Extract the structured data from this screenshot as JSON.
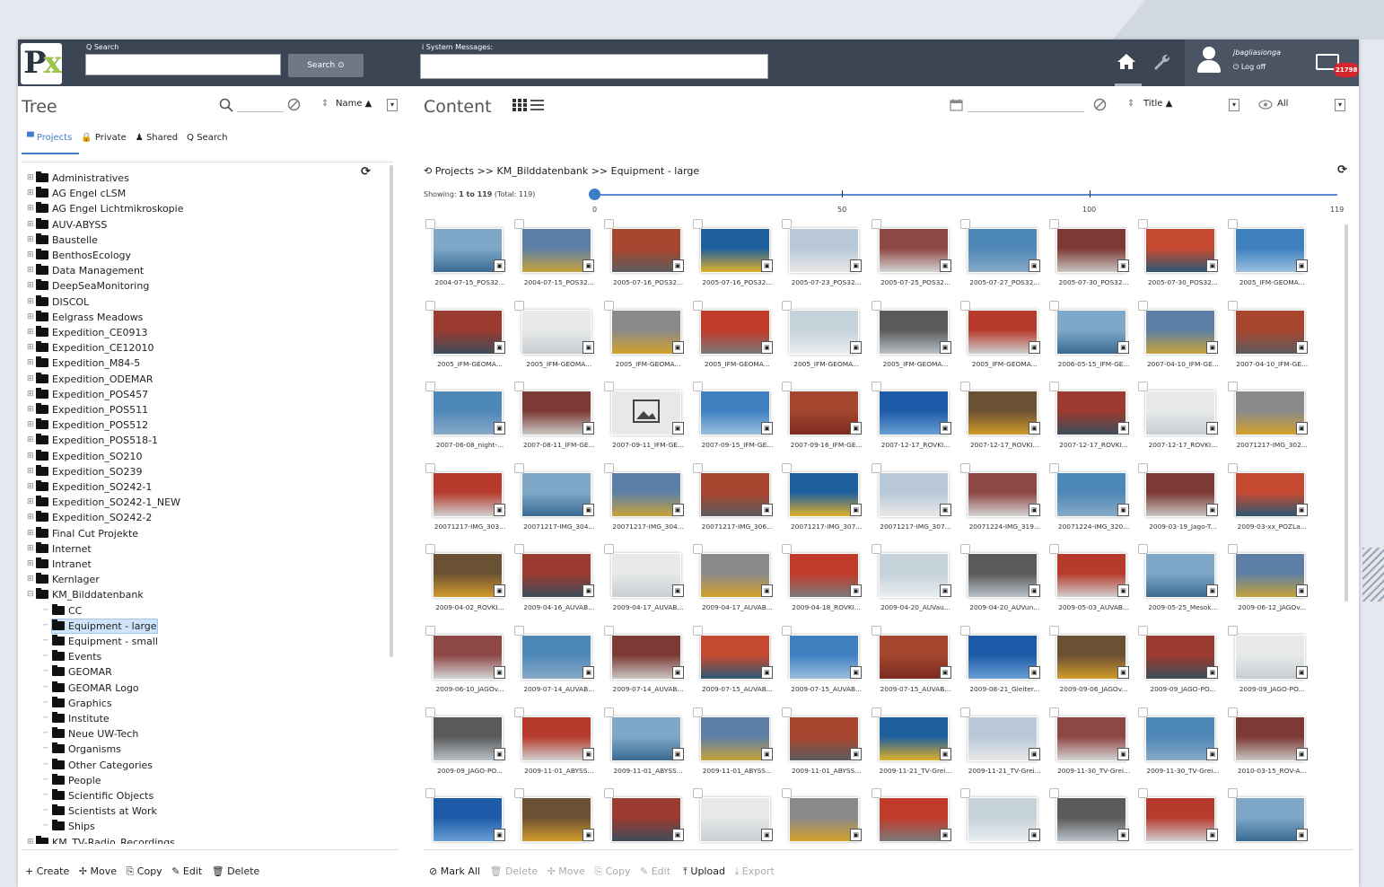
{
  "header": {
    "search_label": "Q Search",
    "search_button": "Search ⊙",
    "system_messages_label": "i System Messages:",
    "user_name": "jbagliasionga",
    "logoff_label": "⏻ Log off",
    "mail_count": "21798"
  },
  "tree": {
    "title": "Tree",
    "sort_label": "Name ▲",
    "tabs": [
      "▀ Projects",
      "🔒 Private",
      "♟ Shared",
      "Q Search"
    ],
    "items": [
      {
        "label": "Administratives",
        "level": 0
      },
      {
        "label": "AG Engel cLSM",
        "level": 0
      },
      {
        "label": "AG Engel Lichtmikroskopie",
        "level": 0
      },
      {
        "label": "AUV-ABYSS",
        "level": 0
      },
      {
        "label": "Baustelle",
        "level": 0
      },
      {
        "label": "BenthosEcology",
        "level": 0
      },
      {
        "label": "Data Management",
        "level": 0
      },
      {
        "label": "DeepSeaMonitoring",
        "level": 0
      },
      {
        "label": "DISCOL",
        "level": 0
      },
      {
        "label": "Eelgrass Meadows",
        "level": 0
      },
      {
        "label": "Expedition_CE0913",
        "level": 0
      },
      {
        "label": "Expedition_CE12010",
        "level": 0
      },
      {
        "label": "Expedition_M84-5",
        "level": 0
      },
      {
        "label": "Expedition_ODEMAR",
        "level": 0
      },
      {
        "label": "Expedition_POS457",
        "level": 0
      },
      {
        "label": "Expedition_POS511",
        "level": 0
      },
      {
        "label": "Expedition_POS512",
        "level": 0
      },
      {
        "label": "Expedition_POS518-1",
        "level": 0
      },
      {
        "label": "Expedition_SO210",
        "level": 0
      },
      {
        "label": "Expedition_SO239",
        "level": 0
      },
      {
        "label": "Expedition_SO242-1",
        "level": 0
      },
      {
        "label": "Expedition_SO242-1_NEW",
        "level": 0
      },
      {
        "label": "Expedition_SO242-2",
        "level": 0
      },
      {
        "label": "Final Cut Projekte",
        "level": 0
      },
      {
        "label": "Internet",
        "level": 0
      },
      {
        "label": "Intranet",
        "level": 0
      },
      {
        "label": "Kernlager",
        "level": 0
      },
      {
        "label": "KM_Bilddatenbank",
        "level": 0,
        "open": true
      },
      {
        "label": "CC",
        "level": 1
      },
      {
        "label": "Equipment - large",
        "level": 1,
        "selected": true
      },
      {
        "label": "Equipment - small",
        "level": 1
      },
      {
        "label": "Events",
        "level": 1
      },
      {
        "label": "GEOMAR",
        "level": 1
      },
      {
        "label": "GEOMAR Logo",
        "level": 1
      },
      {
        "label": "Graphics",
        "level": 1
      },
      {
        "label": "Institute",
        "level": 1
      },
      {
        "label": "Neue UW-Tech",
        "level": 1
      },
      {
        "label": "Organisms",
        "level": 1
      },
      {
        "label": "Other Categories",
        "level": 1
      },
      {
        "label": "People",
        "level": 1
      },
      {
        "label": "Scientific Objects",
        "level": 1
      },
      {
        "label": "Scientists at Work",
        "level": 1
      },
      {
        "label": "Ships",
        "level": 1
      },
      {
        "label": "KM_TV-Radio_Recordings",
        "level": 0
      }
    ],
    "footer": [
      "+ Create",
      "✢ Move",
      "⎘ Copy",
      "✎ Edit",
      "🗑 Delete"
    ]
  },
  "content": {
    "title": "Content",
    "sort_label": "Title ▲",
    "filter_label": "All",
    "breadcrumb": "Projects >> KM_Bilddatenbank >> Equipment - large",
    "showing_prefix": "Showing: ",
    "showing_range": "1 to 119",
    "showing_total": " (Total: 119)",
    "slider_labels": [
      "0",
      "50",
      "100",
      "119"
    ],
    "footer": {
      "active": [
        "⊘ Mark All",
        "⤒ Upload"
      ],
      "disabled": [
        "🗑 Delete",
        "✢ Move",
        "⎘ Copy",
        "✎ Edit",
        "⤓ Export"
      ]
    },
    "thumbnails": [
      "2004-07-15_POS32...",
      "2004-07-15_POS32...",
      "2005-07-16_POS32...",
      "2005-07-16_POS32...",
      "2005-07-23_POS32...",
      "2005-07-25_POS32...",
      "2005-07-27_POS32...",
      "2005-07-30_POS32...",
      "2005-07-30_POS32...",
      "2005_IFM-GEOMA...",
      "2005_IFM-GEOMA...",
      "2005_IFM-GEOMA...",
      "2005_IFM-GEOMA...",
      "2005_IFM-GEOMA...",
      "2005_IFM-GEOMA...",
      "2005_IFM-GEOMA...",
      "2005_IFM-GEOMA...",
      "2006-05-15_IFM-GE...",
      "2007-04-10_IFM-GE...",
      "2007-04-10_IFM-GE...",
      "2007-06-08_night-...",
      "2007-08-11_IFM-GE...",
      "2007-09-11_IFM-GE...",
      "2007-09-15_IFM-GE...",
      "2007-09-16_IFM-GE...",
      "2007-12-17_ROVKI...",
      "2007-12-17_ROVKI...",
      "2007-12-17_ROVKI...",
      "2007-12-17_ROVKI...",
      "20071217-IMG_302...",
      "20071217-IMG_303...",
      "20071217-IMG_304...",
      "20071217-IMG_304...",
      "20071217-IMG_306...",
      "20071217-IMG_307...",
      "20071217-IMG_307...",
      "20071224-IMG_319...",
      "20071224-IMG_320...",
      "2009-03-19_Jago-T...",
      "2009-03-xx_POZLa...",
      "2009-04-02_ROVKI...",
      "2009-04-16_AUVAB...",
      "2009-04-17_AUVAB...",
      "2009-04-17_AUVAB...",
      "2009-04-18_ROVKI...",
      "2009-04-20_AUVau...",
      "2009-04-20_AUVun...",
      "2009-05-03_AUVAB...",
      "2009-05-25_Mesok...",
      "2009-06-12_JAGOv...",
      "2009-06-10_JAGOv...",
      "2009-07-14_AUVAB...",
      "2009-07-14_AUVAB...",
      "2009-07-15_AUVAB...",
      "2009-07-15_AUVAB...",
      "2009-07-15_AUVAB...",
      "2009-08-21_Gleiter...",
      "2009-09-06_JAGOv...",
      "2009-09_JAGO-PO...",
      "2009-09_JAGO-PO...",
      "2009-09_JAGO-PO...",
      "2009-11-01_ABYSS...",
      "2009-11-01_ABYSS...",
      "2009-11-01_ABYSS...",
      "2009-11-01_ABYSS...",
      "2009-11-21_TV-Grei...",
      "2009-11-21_TV-Grei...",
      "2009-11-30_TV-Grei...",
      "2009-11-30_TV-Grei...",
      "2010-03-15_ROV-A...",
      "",
      "",
      "",
      "",
      "",
      "",
      "",
      "",
      "",
      ""
    ]
  },
  "colors": {
    "topbar": "#3b4553",
    "accent": "#3f7dc7",
    "selected_bg": "#cfe4fb",
    "mail_badge": "#d6252b"
  },
  "icons": [
    "home-icon",
    "wrench-icon",
    "user-icon",
    "mail-icon",
    "search-icon",
    "clear-icon",
    "sort-icon",
    "calendar-icon",
    "eye-icon",
    "grid-view-icon",
    "list-view-icon",
    "refresh-icon",
    "history-icon",
    "image-icon"
  ]
}
